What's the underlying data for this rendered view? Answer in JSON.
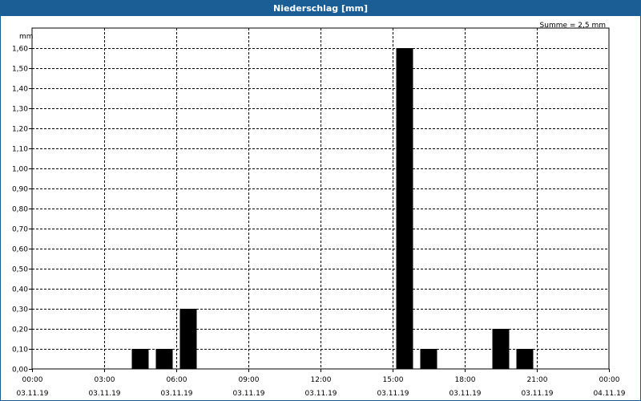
{
  "window": {
    "title": "Niederschlag [mm]",
    "title_bar_color": "#1b5e96"
  },
  "chart_data": {
    "type": "bar",
    "title": "Niederschlag [mm]",
    "ylabel": "mm",
    "annotation": "Summe = 2,5 mm",
    "grid": true,
    "ylim": [
      0,
      1.7
    ],
    "y_ticks": [
      "0,00",
      "0,10",
      "0,20",
      "0,30",
      "0,40",
      "0,50",
      "0,60",
      "0,70",
      "0,80",
      "0,90",
      "1,00",
      "1,10",
      "1,20",
      "1,30",
      "1,40",
      "1,50",
      "1,60"
    ],
    "x_range_hours": [
      0,
      24
    ],
    "x_ticks": [
      {
        "time": "00:00",
        "date": "03.11.19"
      },
      {
        "time": "03:00",
        "date": "03.11.19"
      },
      {
        "time": "06:00",
        "date": "03.11.19"
      },
      {
        "time": "09:00",
        "date": "03.11.19"
      },
      {
        "time": "12:00",
        "date": "03.11.19"
      },
      {
        "time": "15:00",
        "date": "03.11.19"
      },
      {
        "time": "18:00",
        "date": "03.11.19"
      },
      {
        "time": "21:00",
        "date": "03.11.19"
      },
      {
        "time": "00:00",
        "date": "04.11.19"
      }
    ],
    "bars": [
      {
        "hour": 4,
        "value": 0.1
      },
      {
        "hour": 5,
        "value": 0.1
      },
      {
        "hour": 6,
        "value": 0.3
      },
      {
        "hour": 15,
        "value": 1.6
      },
      {
        "hour": 16,
        "value": 0.1
      },
      {
        "hour": 19,
        "value": 0.2
      },
      {
        "hour": 20,
        "value": 0.1
      }
    ],
    "bar_color": "#000000"
  }
}
